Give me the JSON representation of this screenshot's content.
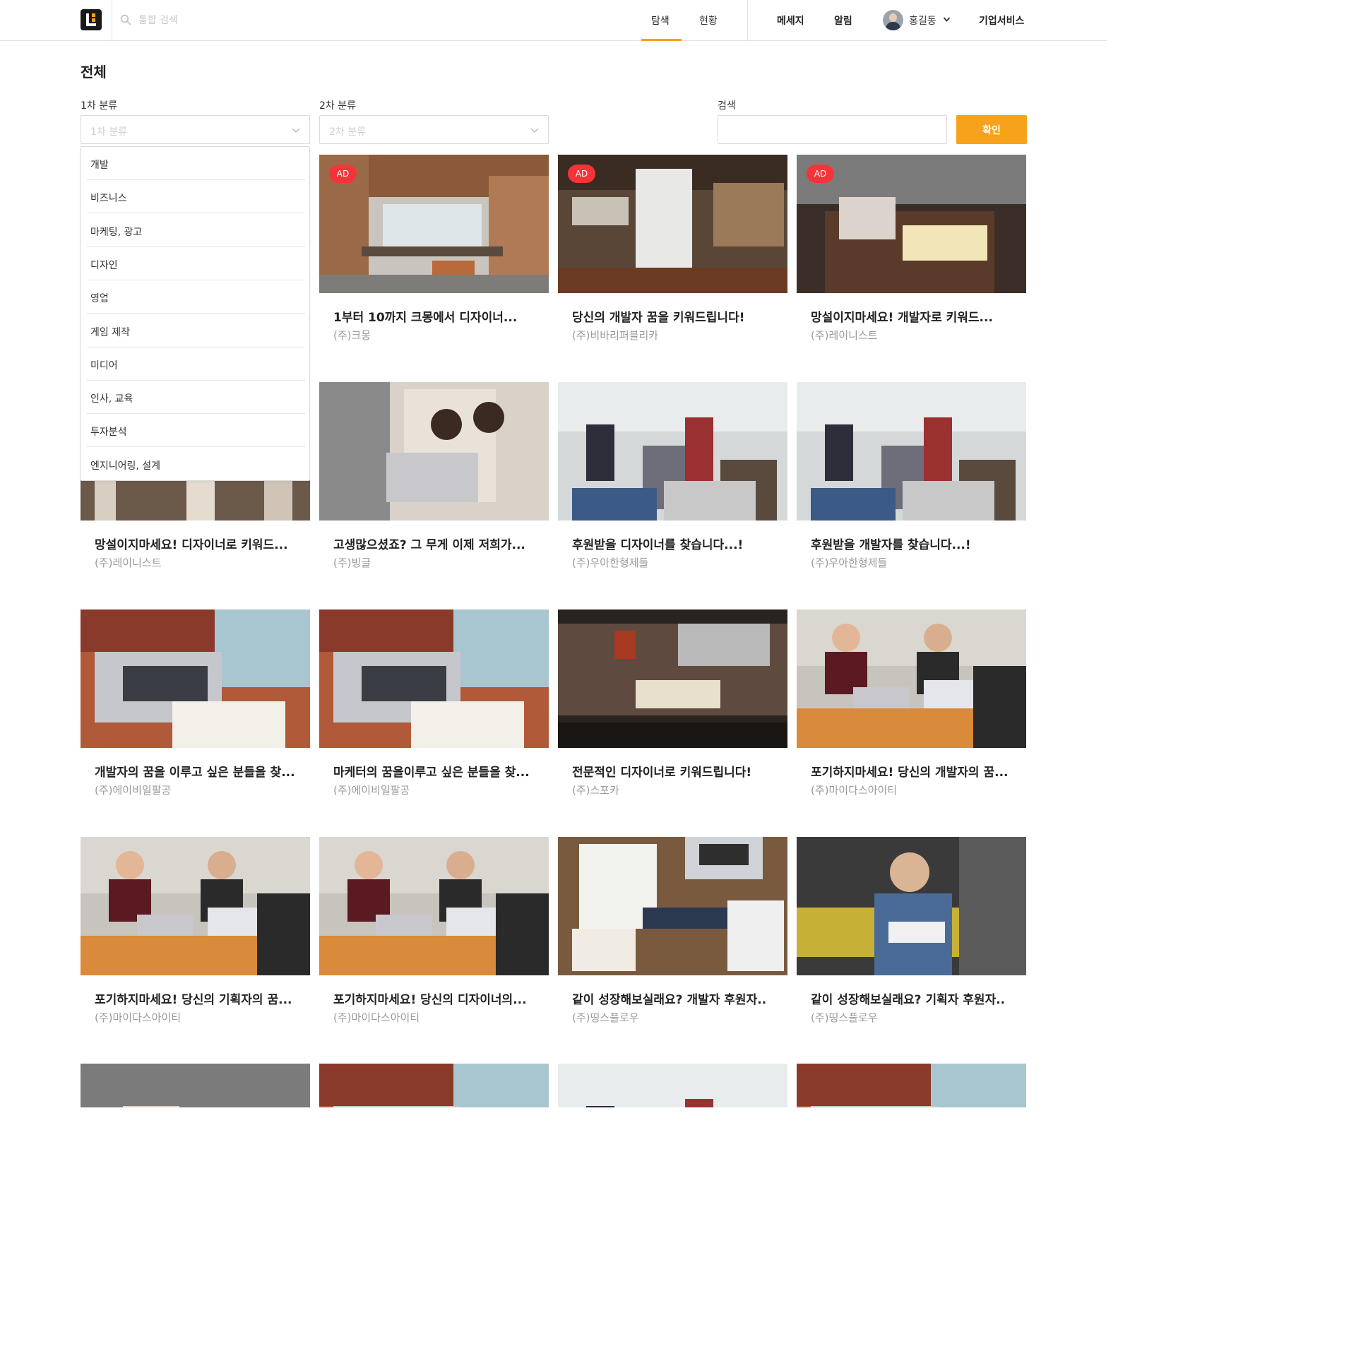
{
  "header": {
    "search_placeholder": "통합 검색",
    "nav": [
      "탐색",
      "현황"
    ],
    "links": {
      "messages": "메세지",
      "alerts": "알림",
      "business": "기업서비스"
    },
    "user_name": "홍길동"
  },
  "page_title": "전체",
  "filters": {
    "first_label": "1차 분류",
    "first_placeholder": "1차 분류",
    "second_label": "2차 분류",
    "second_placeholder": "2차 분류",
    "search_label": "검색",
    "confirm": "확인"
  },
  "dropdown_items": [
    "개발",
    "비즈니스",
    "마케팅, 광고",
    "디자인",
    "영업",
    "게임 제작",
    "미디어",
    "인사, 교육",
    "투자분석",
    "엔지니어링, 설계"
  ],
  "ad_label": "AD",
  "colors": {
    "accent": "#f7a21b",
    "ad": "#f5343a"
  },
  "cards": [
    {
      "title": "1부터 10까지 크몽에서 디자이너...",
      "company": "(주)크몽",
      "ad": true
    },
    {
      "title": "당신의 개발자 꿈을 키워드립니다!",
      "company": "(주)비바리퍼블리카",
      "ad": true
    },
    {
      "title": "망설이지마세요! 개발자로 키워드...",
      "company": "(주)레이니스트",
      "ad": true
    },
    {
      "title": "망설이지마세요! 디자이너로 키워드...",
      "company": "(주)레이니스트",
      "ad": false
    },
    {
      "title": "고생많으셨죠? 그 무게 이제 저희가...",
      "company": "(주)빙글",
      "ad": false
    },
    {
      "title": "후원받을 디자이너를 찾습니다...!",
      "company": "(주)우아한형제들",
      "ad": false
    },
    {
      "title": "후원받을 개발자를 찾습니다...!",
      "company": "(주)우아한형제들",
      "ad": false
    },
    {
      "title": "개발자의 꿈을 이루고 싶은 분들을 찾...",
      "company": "(주)에이비일팔공",
      "ad": false
    },
    {
      "title": "마케터의 꿈을이루고 싶은 분들을 찾...",
      "company": "(주)에이비일팔공",
      "ad": false
    },
    {
      "title": "전문적인 디자이너로 키워드립니다!",
      "company": "(주)스포카",
      "ad": false
    },
    {
      "title": "포기하지마세요! 당신의 개발자의 꿈...",
      "company": "(주)마이다스아이티",
      "ad": false
    },
    {
      "title": "포기하지마세요! 당신의 기획자의 꿈...",
      "company": "(주)마이다스아이티",
      "ad": false
    },
    {
      "title": "포기하지마세요! 당신의 디자이너의...",
      "company": "(주)마이다스아이티",
      "ad": false
    },
    {
      "title": "같이 성장해보실래요? 개발자 후원자..",
      "company": "(주)띵스플로우",
      "ad": false
    },
    {
      "title": "같이 성장해보실래요? 기획자 후원자..",
      "company": "(주)띵스플로우",
      "ad": false
    }
  ]
}
